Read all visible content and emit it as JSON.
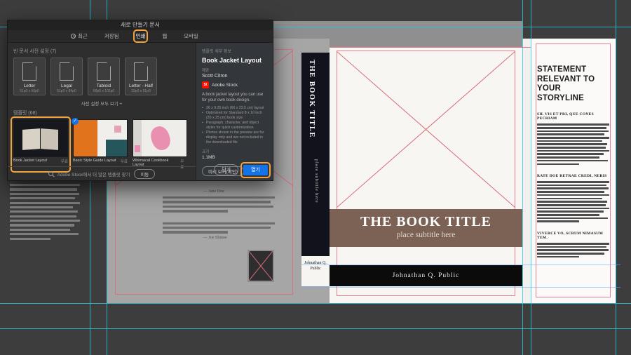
{
  "dialog": {
    "title": "새로 만들기 문서",
    "tabs": {
      "recent": "최근",
      "saved": "저장됨",
      "print": "인쇄",
      "web": "웹",
      "mobile": "모바일"
    },
    "presets": {
      "label": "빈 문서 사전 설정 (7)",
      "items": [
        {
          "name": "Letter",
          "size": "51p0 x 66p0"
        },
        {
          "name": "Legal",
          "size": "51p0 x 84p0"
        },
        {
          "name": "Tabloid",
          "size": "66p0 x 102p0"
        },
        {
          "name": "Letter - Half",
          "size": "33p0 x 51p0"
        }
      ],
      "view_all": "사전 설정 모두 보기 +"
    },
    "templates": {
      "label": "템플릿 (68)",
      "items": [
        {
          "name": "Book Jacket Layout",
          "badge": "무료"
        },
        {
          "name": "Basic Style Guide Layout",
          "badge": "무료"
        },
        {
          "name": "Whimsical Cookbook Layout",
          "badge": "무료"
        }
      ]
    },
    "details": {
      "header": "템플릿 세부 정보",
      "title": "Book Jacket Layout",
      "provider_label": "제공",
      "provider_name": "Scott Citron",
      "stock_icon_text": "St",
      "stock_label": "Adobe Stock",
      "description": "A book jacket layout you can use for your own book design.",
      "bullets": [
        "26 x 9.25 inch (66 x 23.5 cm) layout",
        "Optimized for Standard 8 x 10 inch (20 x 25 cm) book size",
        "Paragraph, character, and object styles for quick customization",
        "Photos shown in the preview are for display only and are not included in the downloaded file"
      ],
      "size_label": "크기",
      "size_value": "1.1MB",
      "preview_button": "미리 보기(확인)"
    },
    "footer": {
      "search_text": "Adobe Stock에서 더 많은 템플릿 찾기",
      "go_button": "이동"
    },
    "actions": {
      "close": "닫기",
      "open": "열기"
    }
  },
  "document": {
    "spine": {
      "title": "THE BOOK TITLE",
      "subtitle": "place subtitle here",
      "author": "Johnathan Q. Public"
    },
    "front_cover": {
      "title": "THE BOOK TITLE",
      "subtitle": "place subtitle here",
      "author": "Johnathan Q. Public"
    },
    "back_cover": {
      "attribution_1": "— Jane Doe",
      "attribution_2": "— Joe Shmoe"
    },
    "front_flap": {
      "heading": "STATEMENT RELEVANT TO YOUR STORYLINE",
      "section_1_heading": "SIL VIS ET PRI, QUE CONES PECRIAM",
      "section_2_heading": "RATE DOE RETRAE CREDI, NERIS",
      "section_3_heading": "VIVERCE VO, SCRUM NIMASUM TEM."
    }
  },
  "colors": {
    "accent_blue": "#1473e6",
    "annotation_orange": "#f2a33c",
    "guide_cyan": "#29cbe2",
    "margin_pink": "#df687a",
    "spine_dark": "#11121c",
    "band_brown": "#7b6254",
    "band_black": "#0b0b0b"
  }
}
